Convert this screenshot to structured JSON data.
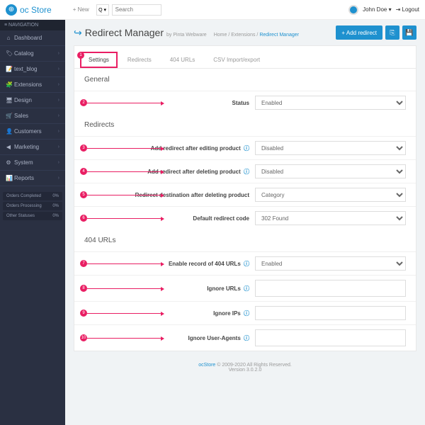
{
  "logo": {
    "text": "oc Store"
  },
  "topbar": {
    "new": "+ New",
    "q": "Q ▾",
    "search_ph": "Search",
    "username": "John Doe ▾",
    "logout": "⇥ Logout"
  },
  "sidebar": {
    "header": "≡ NAVIGATION",
    "items": [
      {
        "icon": "⌂",
        "label": "Dashboard",
        "chev": ""
      },
      {
        "icon": "🏷",
        "label": "Catalog",
        "chev": "›"
      },
      {
        "icon": "📝",
        "label": "text_blog",
        "chev": "›"
      },
      {
        "icon": "🧩",
        "label": "Extensions",
        "chev": "›"
      },
      {
        "icon": "🖥",
        "label": "Design",
        "chev": "›"
      },
      {
        "icon": "🛒",
        "label": "Sales",
        "chev": "›"
      },
      {
        "icon": "👤",
        "label": "Customers",
        "chev": "›"
      },
      {
        "icon": "◀",
        "label": "Marketing",
        "chev": "›"
      },
      {
        "icon": "⚙",
        "label": "System",
        "chev": "›"
      },
      {
        "icon": "📊",
        "label": "Reports",
        "chev": "›"
      }
    ],
    "stats": [
      {
        "label": "Orders Completed",
        "val": "0%"
      },
      {
        "label": "Orders Processing",
        "val": "0%"
      },
      {
        "label": "Other Statuses",
        "val": "0%"
      }
    ]
  },
  "page": {
    "title": "Redirect Manager",
    "by": "by Pinta Webware",
    "crumbs": {
      "home": "Home",
      "ext": "Extensions",
      "cur": "Redirect Manager"
    },
    "add": "+ Add redirect"
  },
  "tabs": {
    "t1": "Settings",
    "t2": "Redirects",
    "t3": "404 URLs",
    "t4": "CSV Import/export"
  },
  "sections": {
    "general": "General",
    "redirects": "Redirects",
    "urls404": "404 URLs"
  },
  "fields": {
    "status": {
      "label": "Status",
      "val": "Enabled"
    },
    "add_edit": {
      "label": "Add redirect after editing product",
      "val": "Disabled"
    },
    "add_del": {
      "label": "Add redirect after deleting product",
      "val": "Disabled"
    },
    "dest": {
      "label": "Redirect destination after deleting product",
      "val": "Category"
    },
    "code": {
      "label": "Default redirect code",
      "val": "302 Found"
    },
    "rec404": {
      "label": "Enable record of 404 URLs",
      "val": "Enabled"
    },
    "ign_url": {
      "label": "Ignore URLs"
    },
    "ign_ip": {
      "label": "Ignore IPs"
    },
    "ign_ua": {
      "label": "Ignore User-Agents"
    }
  },
  "footer": {
    "link": "ocStore",
    "text": " © 2009-2020 All Rights Reserved.",
    "ver": "Version 3.0.2.0"
  }
}
